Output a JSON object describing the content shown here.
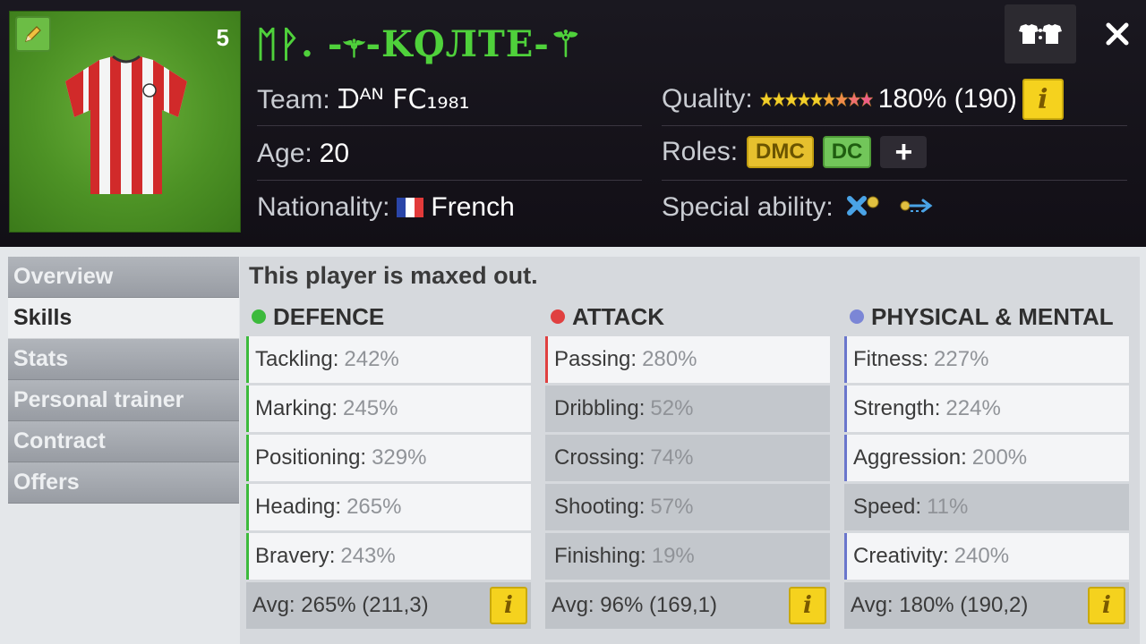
{
  "player": {
    "name": "ᛖᚹ. -⚚-KϘЛТЕ-⚚",
    "shirt_number": "5",
    "team_label": "Team:",
    "team_value": "ᗪᴬᴺ ϜϹ₁₉₈₁",
    "age_label": "Age:",
    "age_value": "20",
    "nationality_label": "Nationality:",
    "nationality_value": "French",
    "quality_label": "Quality:",
    "quality_value": "180% (190)",
    "quality_stars": 9,
    "roles_label": "Roles:",
    "roles": [
      "DMC",
      "DC"
    ],
    "add_role": "+",
    "special_label": "Special ability:"
  },
  "icons": {
    "edit": "pencil-icon",
    "kit": "kit-swap-icon",
    "close": "close-icon",
    "info": "info-icon",
    "flag": "flag-france-icon",
    "ability1": "tackle-ability-icon",
    "ability2": "pass-ability-icon"
  },
  "sidebar": {
    "items": [
      {
        "label": "Overview"
      },
      {
        "label": "Skills"
      },
      {
        "label": "Stats"
      },
      {
        "label": "Personal trainer"
      },
      {
        "label": "Contract"
      },
      {
        "label": "Offers"
      }
    ],
    "active": "Skills"
  },
  "main": {
    "maxed_text": "This player is maxed out.",
    "info_glyph": "i",
    "columns": [
      {
        "title": "DEFENCE",
        "color": "#3cba3c",
        "skills": [
          {
            "name": "Tackling:",
            "value": "242%"
          },
          {
            "name": "Marking:",
            "value": "245%"
          },
          {
            "name": "Positioning:",
            "value": "329%"
          },
          {
            "name": "Heading:",
            "value": "265%"
          },
          {
            "name": "Bravery:",
            "value": "243%"
          }
        ],
        "avg": "Avg: 265% (211,3)"
      },
      {
        "title": "ATTACK",
        "color": "#e04040",
        "skills": [
          {
            "name": "Passing:",
            "value": "280%"
          },
          {
            "name": "Dribbling:",
            "value": "52%"
          },
          {
            "name": "Crossing:",
            "value": "74%"
          },
          {
            "name": "Shooting:",
            "value": "57%"
          },
          {
            "name": "Finishing:",
            "value": "19%"
          }
        ],
        "avg": "Avg: 96% (169,1)"
      },
      {
        "title": "PHYSICAL & MENTAL",
        "color": "#7b86d6",
        "skills": [
          {
            "name": "Fitness:",
            "value": "227%"
          },
          {
            "name": "Strength:",
            "value": "224%"
          },
          {
            "name": "Aggression:",
            "value": "200%"
          },
          {
            "name": "Speed:",
            "value": "11%"
          },
          {
            "name": "Creativity:",
            "value": "240%"
          }
        ],
        "avg": "Avg: 180% (190,2)"
      }
    ]
  }
}
